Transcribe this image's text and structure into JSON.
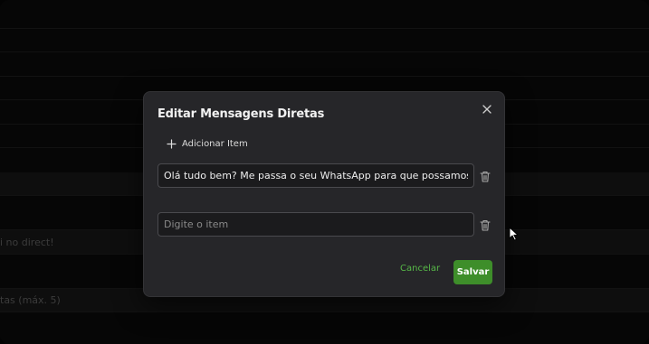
{
  "background": {
    "snippet_top": "",
    "snippet_direct": "i no direct!",
    "snippet_max": "tas (máx. 5)"
  },
  "modal": {
    "title": "Editar Mensagens Diretas",
    "add_item_label": "Adicionar Item",
    "items": [
      {
        "value": "Olá tudo bem? Me passa o seu WhatsApp para que possamos conversar melhor",
        "placeholder": ""
      },
      {
        "value": "",
        "placeholder": "Digite o item"
      }
    ],
    "cancel_label": "Cancelar",
    "save_label": "Salvar"
  },
  "icons": {
    "close": "close-icon",
    "add": "plus-icon",
    "delete": "trash-icon",
    "cursor": "mouse-pointer-icon"
  },
  "colors": {
    "accent": "#3e8e2a",
    "cancel_text": "#57b848",
    "modal_bg": "#262629",
    "page_bg": "#0a0a0a"
  }
}
